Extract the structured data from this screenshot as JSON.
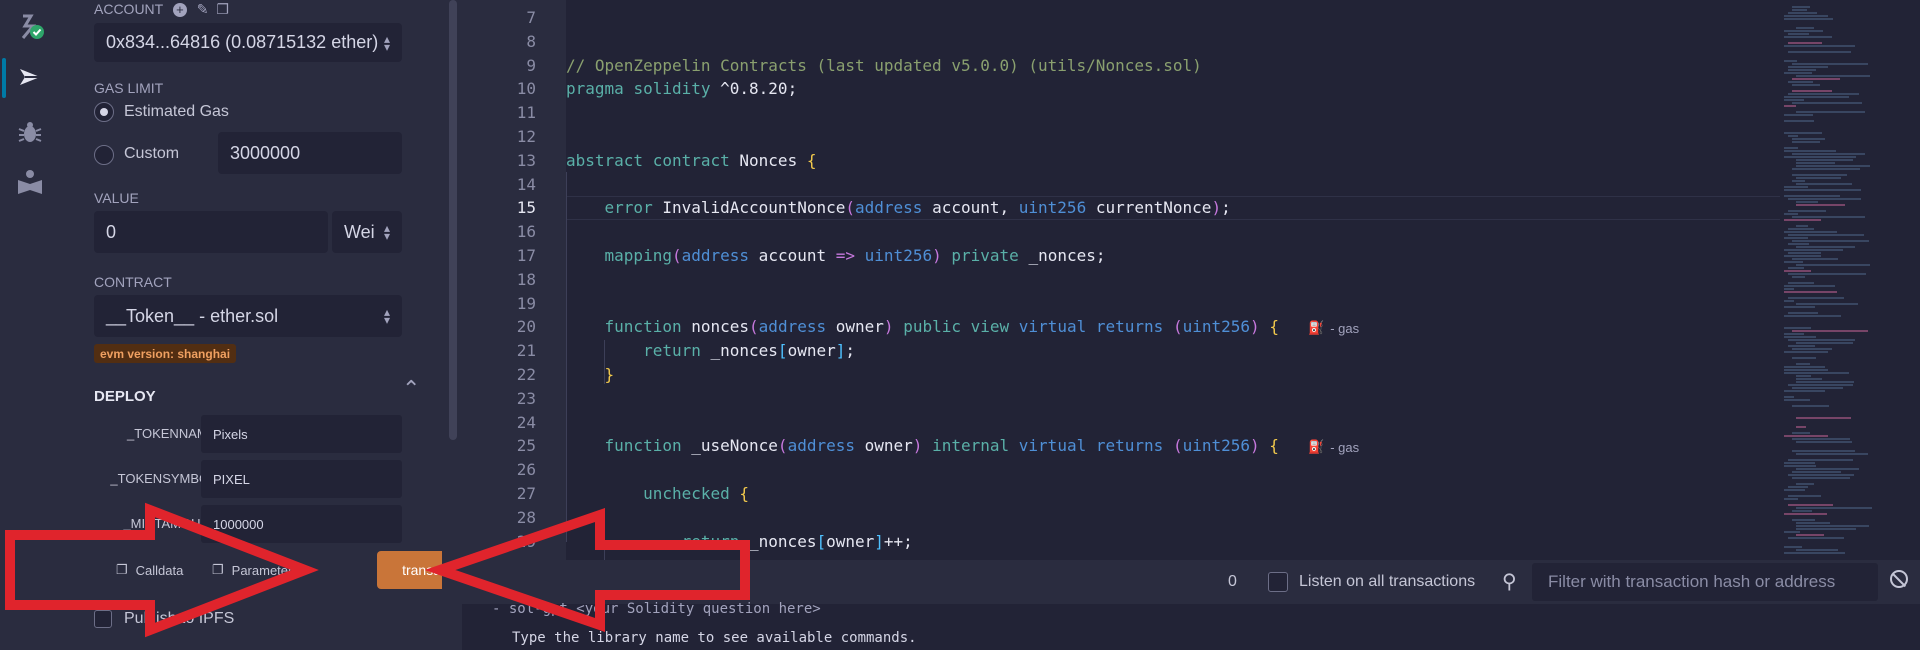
{
  "account": {
    "label": "ACCOUNT",
    "value": "0x834...64816 (0.08715132 ether)"
  },
  "gas": {
    "label": "GAS LIMIT",
    "estimated_label": "Estimated Gas",
    "custom_label": "Custom",
    "custom_value": "3000000",
    "selected": "estimated"
  },
  "value": {
    "label": "VALUE",
    "amount": "0",
    "unit": "Wei"
  },
  "contract": {
    "label": "CONTRACT",
    "value": "__Token__ - ether.sol",
    "evm_badge": "evm version: shanghai"
  },
  "deploy": {
    "title": "DEPLOY",
    "params": [
      {
        "label": "_TOKENNAME:",
        "value": "Pixels"
      },
      {
        "label": "_TOKENSYMBOL:",
        "value": "PIXEL"
      },
      {
        "label": "_MINTAMOUNT:",
        "value": "1000000"
      }
    ],
    "calldata_label": "Calldata",
    "parameters_label": "Parameters",
    "transact_label": "transact",
    "publish_label": "Publish to IPFS"
  },
  "editor": {
    "current_line": 15,
    "lines": [
      {
        "n": "7",
        "text": ""
      },
      {
        "n": "8",
        "text": ""
      },
      {
        "n": "9",
        "text": "// OpenZeppelin Contracts (last updated v5.0.0) (utils/Nonces.sol)"
      },
      {
        "n": "10",
        "text": "pragma solidity ^0.8.20;"
      },
      {
        "n": "11",
        "text": ""
      },
      {
        "n": "12",
        "text": ""
      },
      {
        "n": "13",
        "text": "abstract contract Nonces {"
      },
      {
        "n": "14",
        "text": ""
      },
      {
        "n": "15",
        "text": "    error InvalidAccountNonce(address account, uint256 currentNonce);"
      },
      {
        "n": "16",
        "text": ""
      },
      {
        "n": "17",
        "text": "    mapping(address account => uint256) private _nonces;"
      },
      {
        "n": "18",
        "text": ""
      },
      {
        "n": "19",
        "text": ""
      },
      {
        "n": "20",
        "text": "    function nonces(address owner) public view virtual returns (uint256) {"
      },
      {
        "n": "21",
        "text": "        return _nonces[owner];"
      },
      {
        "n": "22",
        "text": "    }"
      },
      {
        "n": "23",
        "text": ""
      },
      {
        "n": "24",
        "text": ""
      },
      {
        "n": "25",
        "text": "    function _useNonce(address owner) internal virtual returns (uint256) {"
      },
      {
        "n": "26",
        "text": ""
      },
      {
        "n": "27",
        "text": "        unchecked {"
      },
      {
        "n": "28",
        "text": ""
      },
      {
        "n": "29",
        "text": "            return _nonces[owner]++;"
      }
    ],
    "gas_hint": "- gas"
  },
  "terminal": {
    "count": "0",
    "listen_label": "Listen on all transactions",
    "filter_placeholder": "Filter with transaction hash or address",
    "line1": "- sol-gpt <your Solidity question here>",
    "line2": "Type the library name to see available commands."
  },
  "colors": {
    "bg": "#222336",
    "panel": "#2a2c3f",
    "transact": "#c97539",
    "annotation": "#e0242c"
  }
}
